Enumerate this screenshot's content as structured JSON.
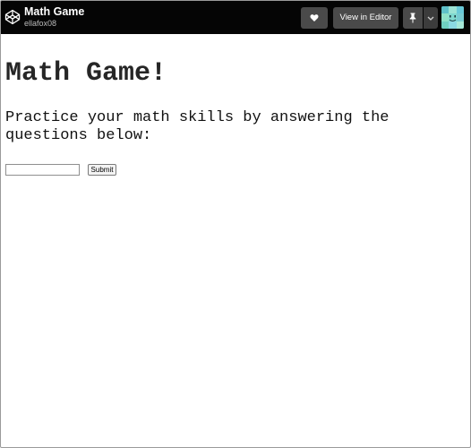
{
  "header": {
    "title": "Math Game",
    "author": "ellafox08",
    "logo_icon": "codepen-logo-icon",
    "like_icon": "heart-icon",
    "editor_label": "View in Editor",
    "pin_icon": "pin-icon",
    "menu_icon": "chevron-down-icon",
    "bar_color": "#050505",
    "button_color": "#4a4a4a"
  },
  "page": {
    "heading": "Math Game!",
    "intro": "Practice your math skills by answering the questions below:",
    "answer_value": "",
    "answer_placeholder": "",
    "submit_label": "Submit"
  }
}
